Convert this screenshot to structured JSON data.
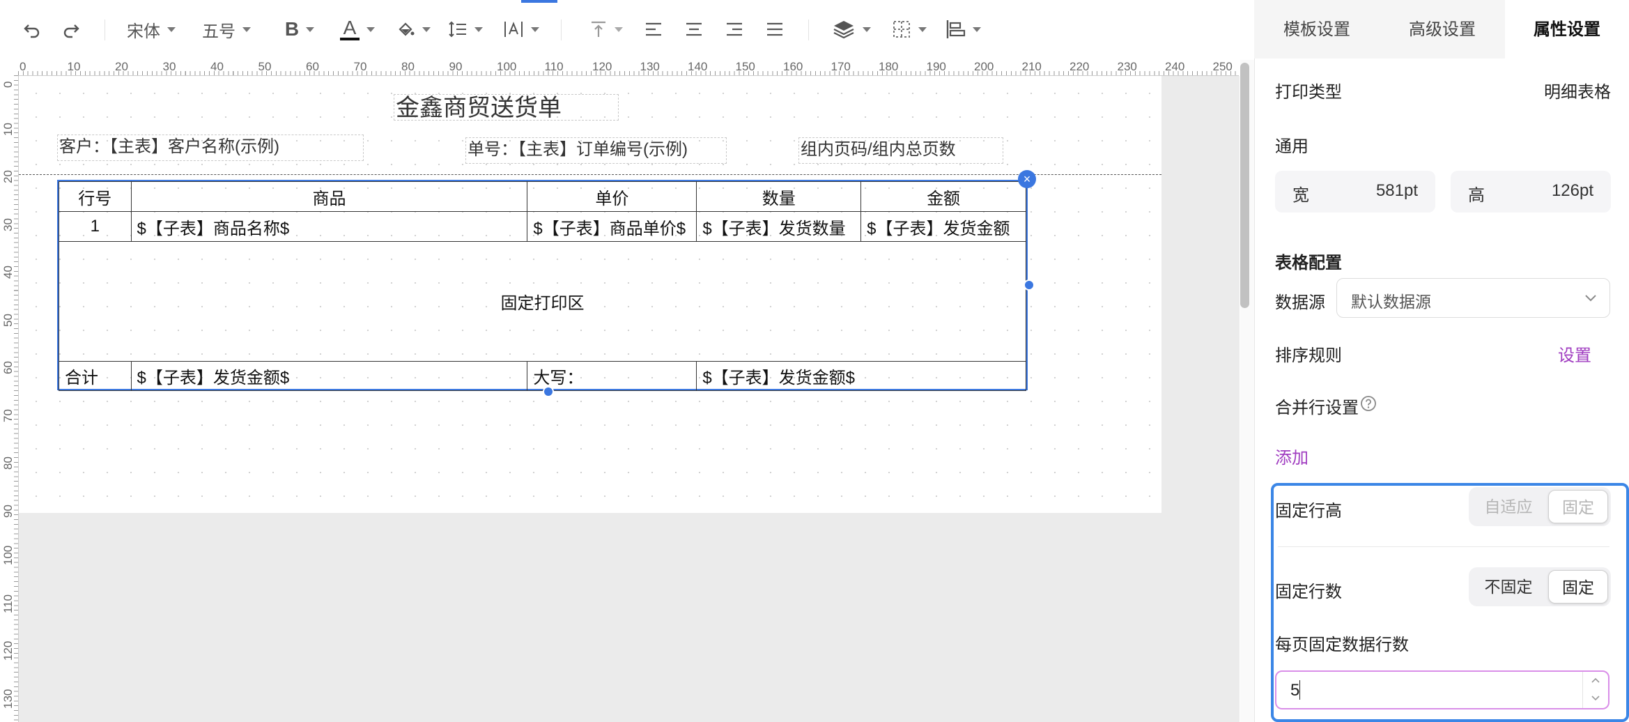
{
  "toolbar": {
    "undo_icon": "undo-icon",
    "redo_icon": "redo-icon",
    "font_family": "宋体",
    "font_size": "五号",
    "bold_label": "B",
    "font_color_label": "A"
  },
  "ruler": {
    "h_marks": [
      "0",
      "10",
      "20",
      "30",
      "40",
      "50",
      "60",
      "70",
      "80",
      "90",
      "100",
      "110",
      "120",
      "130",
      "140",
      "150",
      "160",
      "170",
      "180",
      "190",
      "200",
      "210",
      "220",
      "230",
      "240",
      "250"
    ],
    "v_marks": [
      "0",
      "10",
      "20",
      "30",
      "40",
      "50",
      "60",
      "70",
      "80",
      "90",
      "100",
      "110",
      "120",
      "130"
    ]
  },
  "canvas": {
    "title": "金鑫商贸送货单",
    "customer_field": "客户：【主表】客户名称(示例)",
    "order_field": "单号：【主表】订单编号(示例)",
    "page_field": "组内页码/组内总页数",
    "close_label": "×",
    "table": {
      "headers": [
        "行号",
        "商品",
        "单价",
        "数量",
        "金额"
      ],
      "row": [
        "1",
        "$【子表】商品名称$",
        "$【子表】商品单价$",
        "$【子表】发货数量",
        "$【子表】发货金额"
      ],
      "fixed_area": "固定打印区",
      "footer": [
        "合计",
        "$【子表】发货金额$",
        "大写：",
        "$【子表】发货金额$"
      ]
    }
  },
  "panel": {
    "tabs": [
      "模板设置",
      "高级设置",
      "属性设置"
    ],
    "active_tab": "属性设置",
    "print_type_label": "打印类型",
    "print_type_value": "明细表格",
    "general_label": "通用",
    "width_label": "宽",
    "width_value": "581pt",
    "height_label": "高",
    "height_value": "126pt",
    "table_config_label": "表格配置",
    "datasource_label": "数据源",
    "datasource_value": "默认数据源",
    "sort_label": "排序规则",
    "sort_action": "设置",
    "merge_label": "合并行设置",
    "merge_add": "添加",
    "fixed_row_height_label": "固定行高",
    "fixed_row_height_options": [
      "自适应",
      "固定"
    ],
    "fixed_row_count_label": "固定行数",
    "fixed_row_count_options": [
      "不固定",
      "固定"
    ],
    "rows_per_page_label": "每页固定数据行数",
    "rows_per_page_value": "5"
  },
  "colors": {
    "accent_blue": "#3b77e0",
    "purple_link": "#a03cc0",
    "highlight_border": "#3b86e6"
  }
}
